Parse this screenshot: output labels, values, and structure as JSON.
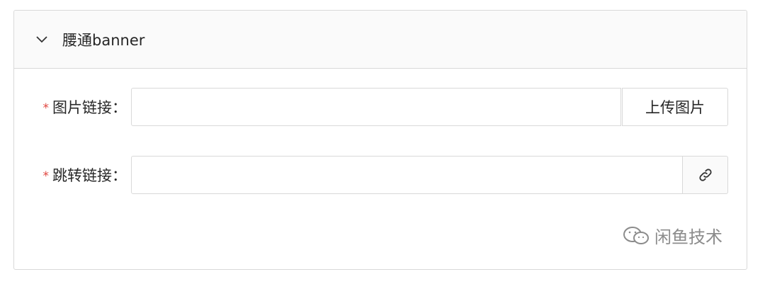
{
  "panel": {
    "title": "腰通banner",
    "expanded": true,
    "chevron_icon": "chevron-down-icon"
  },
  "form": {
    "image_link": {
      "required_mark": "*",
      "label": "图片链接：",
      "value": "",
      "upload_button": "上传图片"
    },
    "jump_link": {
      "required_mark": "*",
      "label": "跳转链接：",
      "value": "",
      "addon_icon": "link-icon"
    }
  },
  "watermark": {
    "icon": "wechat-icon",
    "text": "闲鱼技术"
  },
  "colors": {
    "required": "#e0463f",
    "border": "#d9d9d9",
    "header_bg": "#fafafa"
  }
}
